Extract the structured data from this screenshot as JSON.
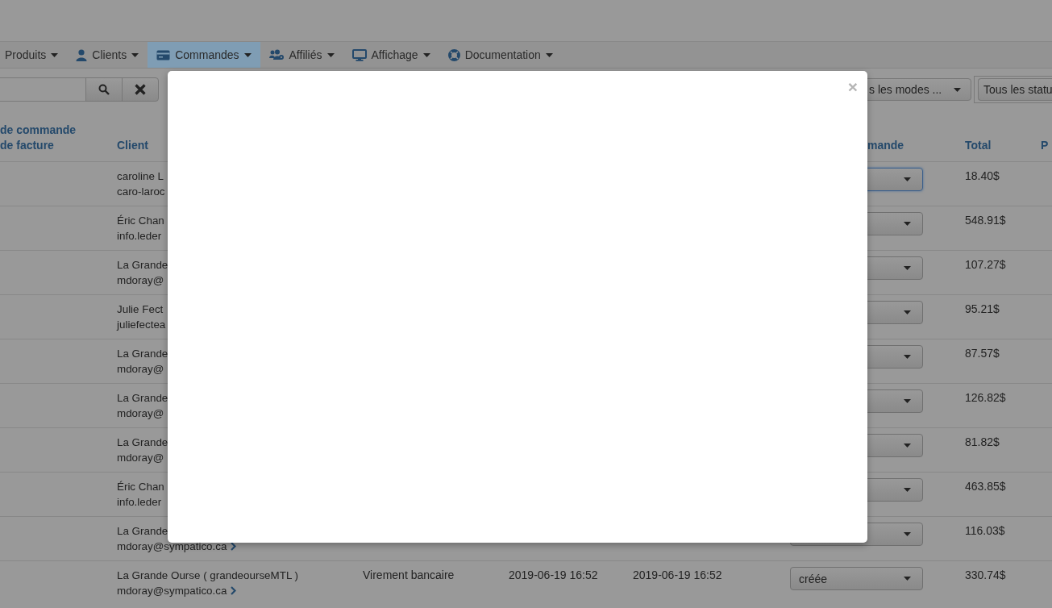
{
  "nav": [
    {
      "label": "Produits",
      "selected": false
    },
    {
      "label": "Clients",
      "selected": false
    },
    {
      "label": "Commandes",
      "selected": true
    },
    {
      "label": "Affiliés",
      "selected": false
    },
    {
      "label": "Affichage",
      "selected": false
    },
    {
      "label": "Documentation",
      "selected": false
    }
  ],
  "toolbar": {
    "payment_filter": "s les modes ...",
    "status_filter": "Tous les statu"
  },
  "table": {
    "columns": {
      "column_1": [
        "de commande",
        "de facture"
      ],
      "client": "Client",
      "status": "mande",
      "total": "Total",
      "column_8": "P"
    },
    "rows": [
      {
        "client": "caroline L",
        "email": "caro-laroc",
        "status": {
          "focused": true
        },
        "total": "18.40$"
      },
      {
        "client": "Éric Chan",
        "email": "info.leder",
        "status": {
          "focused": false
        },
        "total": "548.91$"
      },
      {
        "client": "La Grande",
        "email": "mdoray@",
        "status": {
          "focused": false
        },
        "total": "107.27$"
      },
      {
        "client": "Julie Fect",
        "email": "juliefectea",
        "status": {
          "focused": false
        },
        "total": "95.21$"
      },
      {
        "client": "La Grande",
        "email": "mdoray@",
        "status": {
          "focused": false
        },
        "total": "87.57$"
      },
      {
        "client": "La Grande",
        "email": "mdoray@",
        "status": {
          "focused": false
        },
        "total": "126.82$"
      },
      {
        "client": "La Grande",
        "email": "mdoray@",
        "status": {
          "focused": false
        },
        "total": "81.82$"
      },
      {
        "client": "Éric Chan",
        "email": "info.leder",
        "status": {
          "focused": false
        },
        "total": "463.85$"
      },
      {
        "client": "La Grande",
        "email": "mdoray@sympatico.ca",
        "link_icon": true,
        "status": {
          "focused": false
        },
        "total": "116.03$"
      },
      {
        "client": "La Grande Ourse ( grandeourseMTL )",
        "email": "mdoray@sympatico.ca",
        "link_icon": true,
        "payment": "Virement bancaire",
        "created": "2019-06-19 16:52",
        "updated": "2019-06-19 16:52",
        "status": {
          "value": "créée",
          "focused": false
        },
        "total": "330.74$"
      }
    ]
  },
  "modal": {
    "close": "×"
  }
}
